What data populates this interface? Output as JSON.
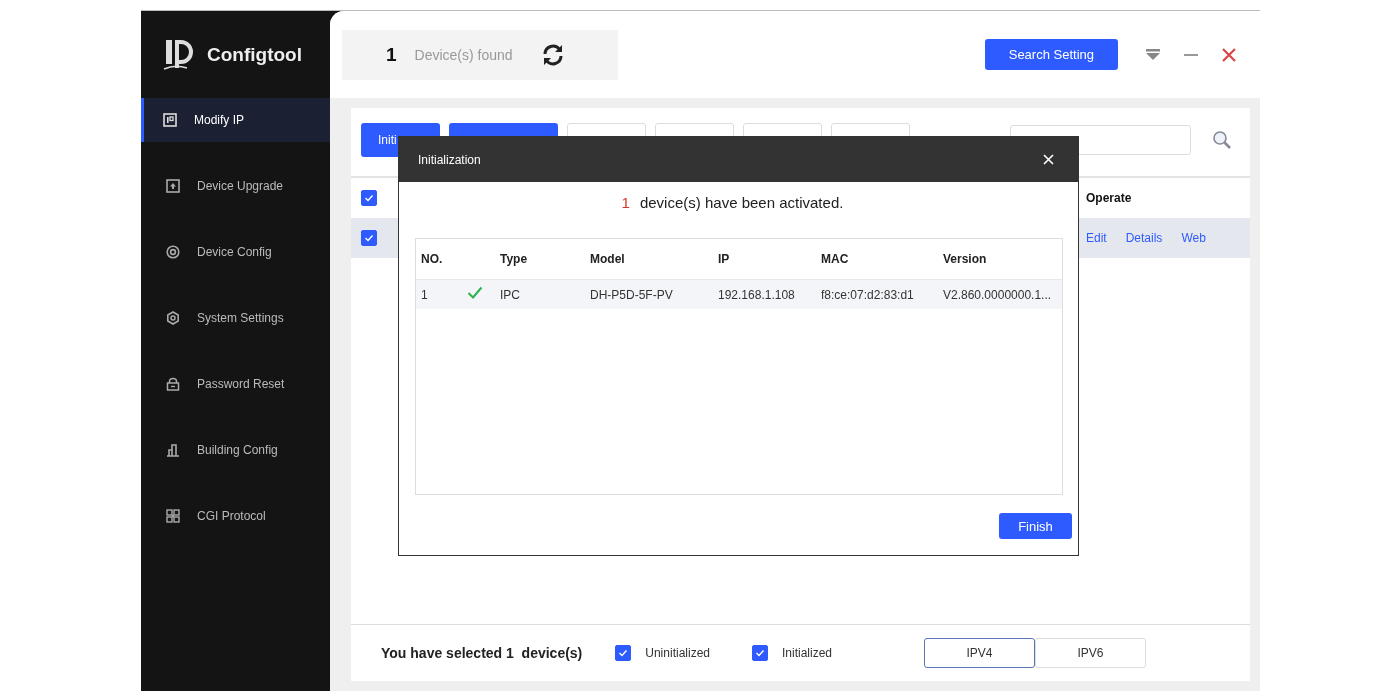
{
  "app": {
    "name": "Configtool"
  },
  "sidebar": {
    "items": [
      {
        "label": "Modify IP",
        "kind": "ip",
        "selected": true
      },
      {
        "label": "Device Upgrade",
        "kind": "upgrade",
        "selected": false
      },
      {
        "label": "Device Config",
        "kind": "config",
        "selected": false
      },
      {
        "label": "System Settings",
        "kind": "settings",
        "selected": false
      },
      {
        "label": "Password Reset",
        "kind": "password",
        "selected": false
      },
      {
        "label": "Building Config",
        "kind": "building",
        "selected": false
      },
      {
        "label": "CGI Protocol",
        "kind": "cgi",
        "selected": false
      }
    ]
  },
  "header": {
    "count": "1",
    "label": "Device(s) found",
    "search_setting": "Search Setting"
  },
  "toolbar": {
    "buttons": [
      {
        "label": "Initi",
        "kind": "primary"
      },
      {
        "kind": "primary"
      },
      {
        "kind": "outline"
      },
      {
        "kind": "outline"
      },
      {
        "kind": "outline"
      },
      {
        "kind": "outline"
      }
    ]
  },
  "device_table": {
    "header_checked": true,
    "columns": [
      "Operate"
    ],
    "rows": [
      {
        "checked": true,
        "selected": true,
        "actions": [
          "Edit",
          "Details",
          "Web"
        ]
      }
    ]
  },
  "footer": {
    "selected_text": "You have selected 1  device(s)",
    "filters": [
      {
        "label": "Uninitialized",
        "checked": true
      },
      {
        "label": "Initialized",
        "checked": true
      }
    ],
    "protocols": [
      {
        "label": "IPV4",
        "selected": true
      },
      {
        "label": "IPV6",
        "selected": false
      }
    ]
  },
  "dialog": {
    "title": "Initialization",
    "count": "1",
    "message": "device(s) have been activated.",
    "columns": [
      "NO.",
      "Type",
      "Model",
      "IP",
      "MAC",
      "Version"
    ],
    "rows": [
      {
        "no": "1",
        "success": true,
        "type": "IPC",
        "model": "DH-P5D-5F-PV",
        "ip": "192.168.1.108",
        "mac": "f8:ce:07:d2:83:d1",
        "version": "V2.860.0000000.1..."
      }
    ],
    "finish": "Finish"
  }
}
